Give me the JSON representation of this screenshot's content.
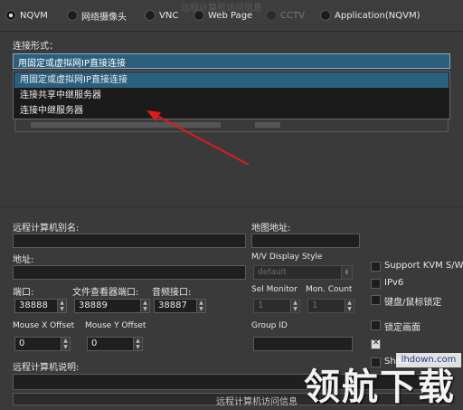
{
  "header": {
    "title": "远程计算机访问信息",
    "radios": [
      {
        "label": "NQVM",
        "checked": true,
        "disabled": false
      },
      {
        "label": "网络摄像头",
        "checked": false,
        "disabled": false
      },
      {
        "label": "VNC",
        "checked": false,
        "disabled": false
      },
      {
        "label": "Web Page",
        "checked": false,
        "disabled": false
      },
      {
        "label": "CCTV",
        "checked": false,
        "disabled": true
      },
      {
        "label": "Application(NQVM)",
        "checked": false,
        "disabled": false
      }
    ]
  },
  "connection": {
    "label": "连接形式：",
    "selected": "用固定或虚拟网IP直接连接",
    "options": [
      "用固定或虚拟网IP直接连接",
      "连接共享中继服务器",
      "连接中继服务器"
    ]
  },
  "form": {
    "alias_label": "远程计算机别名:",
    "alias_value": "",
    "map_label": "地图地址:",
    "map_value": "",
    "address_label": "地址:",
    "address_value": "",
    "mv_label": "M/V Display Style",
    "mv_value": "default",
    "port_label": "端口:",
    "port_value": "38888",
    "fileviewer_label": "文件查看器端口:",
    "fileviewer_value": "38889",
    "audio_label": "音频接口:",
    "audio_value": "38887",
    "selmon_label": "Sel Monitor",
    "selmon_value": "1",
    "moncount_label": "Mon. Count",
    "moncount_value": "1",
    "mousex_label": "Mouse X Offset",
    "mousex_value": "0",
    "mousey_label": "Mouse Y Offset",
    "mousey_value": "0",
    "group_label": "Group ID",
    "group_value": "",
    "desc_label": "远程计算机说明:",
    "desc_value": ""
  },
  "options": {
    "support_kvm": {
      "label": "Support KVM S/W",
      "checked": false
    },
    "ipv6": {
      "label": "IPv6",
      "checked": false
    },
    "kbd_lock": {
      "label": "键盘/鼠标锁定",
      "checked": false
    },
    "screen_lock": {
      "label": "锁定画面",
      "checked": false
    },
    "checked_item": {
      "label": "",
      "checked": true
    },
    "show_item": {
      "label": "Show",
      "checked": false
    }
  },
  "bottom_button": "远程计算机访问信息",
  "watermark": {
    "site": "lhdown.com",
    "text": "领航下载"
  },
  "colors": {
    "accent": "#2a5f7e",
    "background": "#3a3a3a",
    "arrow": "#e01b1b"
  }
}
